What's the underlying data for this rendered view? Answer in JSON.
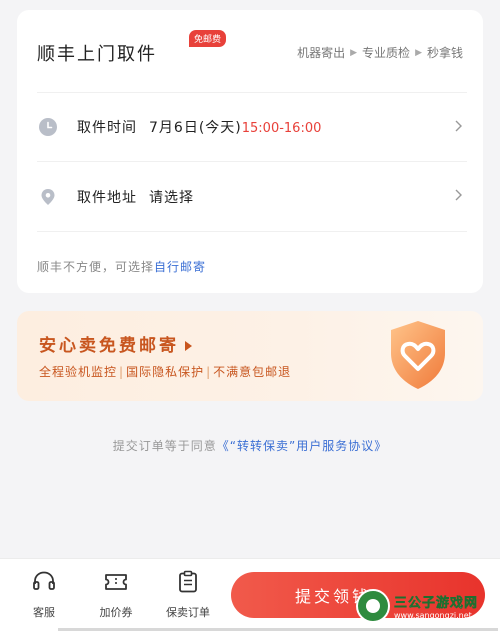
{
  "pickup_card": {
    "title": "顺丰上门取件",
    "badge": "免邮费",
    "steps": [
      "机器寄出",
      "专业质检",
      "秒拿钱"
    ],
    "time_row": {
      "label": "取件时间",
      "date": "7月6日(今天)",
      "time": "15:00-16:00"
    },
    "address_row": {
      "label": "取件地址",
      "value": "请选择"
    },
    "note": {
      "text": "顺丰不方便，可选择",
      "link": "自行邮寄"
    }
  },
  "promo": {
    "title": "安心卖免费邮寄",
    "features": [
      "全程验机监控",
      "国际隐私保护",
      "不满意包邮退"
    ]
  },
  "agreement": {
    "text": "提交订单等于同意",
    "link": "《“转转保卖”用户服务协议》"
  },
  "bottom_bar": {
    "tabs": [
      {
        "label": "客服",
        "icon": "headset-icon"
      },
      {
        "label": "加价券",
        "icon": "ticket-icon"
      },
      {
        "label": "保卖订单",
        "icon": "clipboard-icon"
      }
    ],
    "submit_label": "提交领钱"
  },
  "watermark": {
    "title": "三公子游戏网",
    "url": "www.sangongzi.net"
  },
  "colors": {
    "accent": "#e8413a",
    "link": "#3b6fd4",
    "promo_text": "#c8561f"
  }
}
